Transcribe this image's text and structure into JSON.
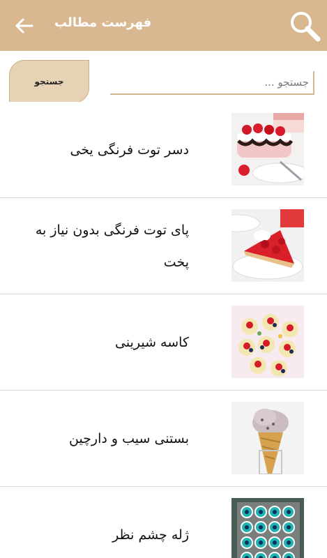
{
  "header": {
    "title": "فهرست مطالب",
    "back_icon": "arrow-left-icon",
    "search_icon": "magnifier-icon",
    "background": "#d8b791"
  },
  "search": {
    "button_label": "جستجو",
    "placeholder": "جستجو ...",
    "value": ""
  },
  "items": [
    {
      "title": "دسر توت فرنگی یخی",
      "thumb": "strawberry-roll-dessert-image"
    },
    {
      "title": "پای توت فرنگی بدون نیاز به پخت",
      "thumb": "strawberry-pie-image"
    },
    {
      "title": "کاسه شیرینی",
      "thumb": "fruit-tartlets-image"
    },
    {
      "title": "بستنی سیب و دارچین",
      "thumb": "ice-cream-cone-image"
    },
    {
      "title": "ژله چشم نظر",
      "thumb": "eye-jelly-tray-image"
    }
  ]
}
